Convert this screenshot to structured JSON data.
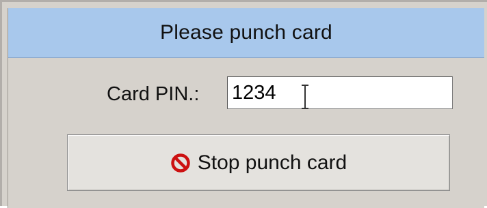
{
  "dialog": {
    "title": "Please punch card"
  },
  "pin": {
    "label": "Card PIN.:",
    "value": "1234"
  },
  "stop_button": {
    "label": "Stop punch card",
    "icon": "no-entry-icon",
    "icon_color": "#cc1111"
  },
  "colors": {
    "title_bar": "#a8c8ec",
    "dialog_bg": "#d6d2cc"
  }
}
